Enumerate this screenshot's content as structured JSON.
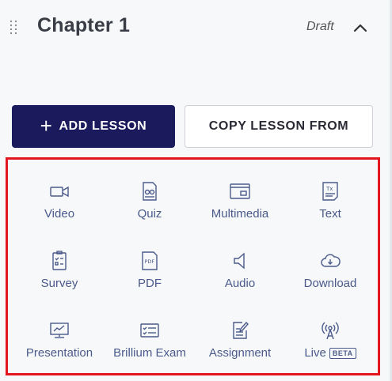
{
  "chapter": {
    "title": "Chapter 1",
    "status": "Draft"
  },
  "actions": {
    "add_lesson_plus": "+",
    "add_lesson_label": "ADD LESSON",
    "copy_lesson_label": "COPY LESSON FROM"
  },
  "lesson_types": [
    {
      "label": "Video",
      "icon": "video-icon"
    },
    {
      "label": "Quiz",
      "icon": "quiz-icon"
    },
    {
      "label": "Multimedia",
      "icon": "multimedia-icon"
    },
    {
      "label": "Text",
      "icon": "text-icon"
    },
    {
      "label": "Survey",
      "icon": "survey-icon"
    },
    {
      "label": "PDF",
      "icon": "pdf-icon"
    },
    {
      "label": "Audio",
      "icon": "audio-icon"
    },
    {
      "label": "Download",
      "icon": "download-icon"
    },
    {
      "label": "Presentation",
      "icon": "presentation-icon"
    },
    {
      "label": "Brillium Exam",
      "icon": "brillium-exam-icon"
    },
    {
      "label": "Assignment",
      "icon": "assignment-icon"
    },
    {
      "label": "Live",
      "icon": "live-icon",
      "badge": "BETA"
    }
  ],
  "colors": {
    "primary": "#1b1a5c",
    "highlight_border": "#e3161f",
    "icon": "#4a5a8a",
    "background": "#f7f8fa"
  }
}
